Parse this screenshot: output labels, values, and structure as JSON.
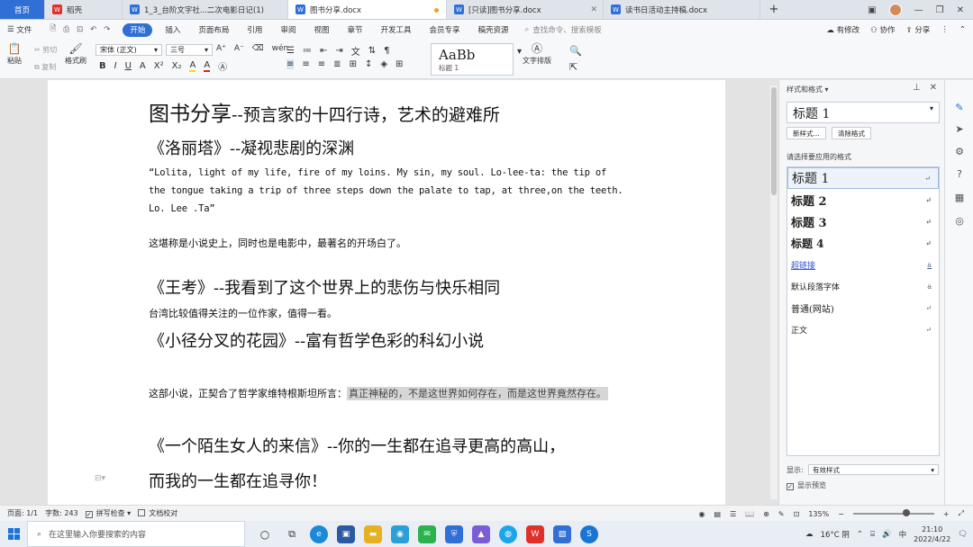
{
  "tabs": [
    {
      "label": "首页",
      "kind": "home"
    },
    {
      "label": "稻壳",
      "kind": "wps"
    },
    {
      "label": "1_3_台阶文字社...二次电影日记(1)",
      "kind": "doc"
    },
    {
      "label": "图书分享.docx",
      "kind": "doc",
      "active": true
    },
    {
      "label": "[只读]图书分享.docx",
      "kind": "doc"
    },
    {
      "label": "读书日活动主持稿.docx",
      "kind": "doc"
    }
  ],
  "menu": {
    "file": "文件",
    "items": [
      "开始",
      "插入",
      "页面布局",
      "引用",
      "审阅",
      "视图",
      "章节",
      "开发工具",
      "会员专享",
      "稿壳资源"
    ],
    "search_placeholder": "查找命令、搜索模板",
    "right": [
      "有修改",
      "协作",
      "分享"
    ]
  },
  "toolbar": {
    "paste": "粘贴",
    "cut": "剪切",
    "copy": "复制",
    "format_painter": "格式刷",
    "font_name": "宋体 (正文)",
    "font_size": "三号",
    "style_preview": "AaBb",
    "style_name": "标题 1",
    "text_layout": "文字排版"
  },
  "doc": {
    "title": "图书分享",
    "title_sub": "--预言家的十四行诗，艺术的避难所",
    "h_lolita": "《洛丽塔》--凝视悲剧的深渊",
    "quote": "“Lolita, light of my life, fire of my loins. My sin, my soul. Lo-lee-ta: the tip of the tongue taking a trip of three steps down the palate to tap, at three,on the teeth. Lo. Lee .Ta”",
    "p_lolita": "这堪称是小说史上，同时也是电影中，最著名的开场白了。",
    "h_wangkao": "《王考》--我看到了这个世界上的悲伤与快乐相同",
    "p_wangkao": "台湾比较值得关注的一位作家，值得一看。",
    "h_garden": "《小径分叉的花园》--富有哲学色彩的科幻小说",
    "p_garden": "这部小说，正契合了哲学家维特根斯坦所言：",
    "p_garden_hl": "真正神秘的，不是这世界如何存在，而是这世界竟然存在。",
    "h_letter1": "《一个陌生女人的来信》--你的一生都在追寻更高的高山，",
    "h_letter2": "而我的一生都在追寻你！"
  },
  "panel": {
    "title": "样式和格式",
    "current": "标题 1",
    "new_style": "新样式...",
    "clear_format": "清除格式",
    "choose_label": "请选择要应用的格式",
    "styles": [
      {
        "name": "标题 1",
        "mark": "↵"
      },
      {
        "name": "标题 2",
        "mark": "↵"
      },
      {
        "name": "标题 3",
        "mark": "↵"
      },
      {
        "name": "标题 4",
        "mark": "↵"
      },
      {
        "name": "超链接",
        "mark": "a"
      },
      {
        "name": "默认段落字体",
        "mark": "a"
      },
      {
        "name": "普通(网站)",
        "mark": "↵"
      },
      {
        "name": "正文",
        "mark": "↵"
      }
    ],
    "show_label": "显示:",
    "show_value": "有效样式",
    "preview_label": "显示预览"
  },
  "status": {
    "page": "页面: 1/1",
    "words": "字数: 243",
    "spell": "拼写检查",
    "proof": "文档校对",
    "zoom": "135%"
  },
  "taskbar": {
    "search_placeholder": "在这里输入你要搜索的内容",
    "weather": "16°C 阴",
    "lang": "中",
    "time": "21:10",
    "date": "2022/4/22"
  }
}
